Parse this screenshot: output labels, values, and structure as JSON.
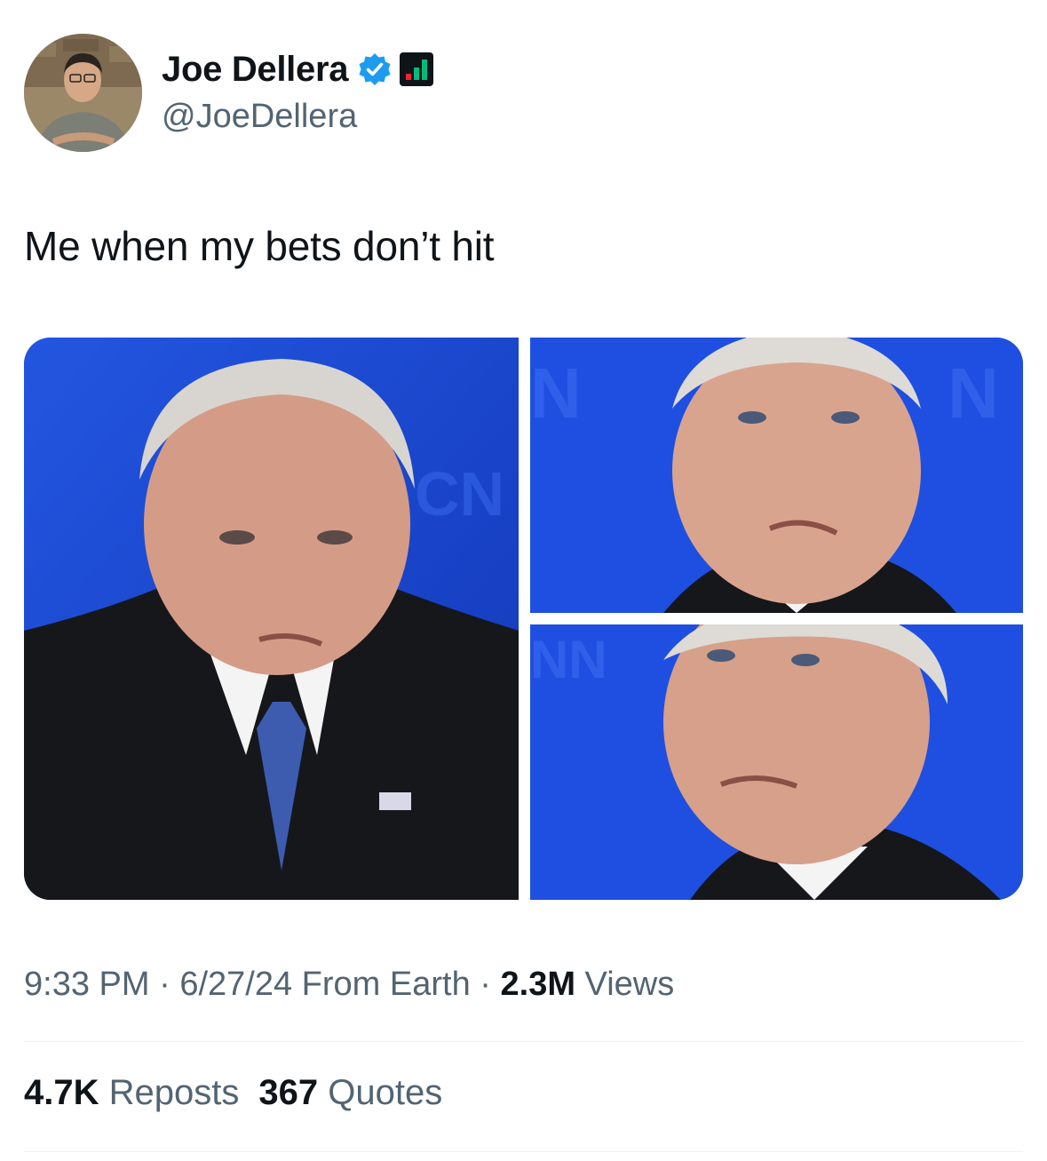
{
  "author": {
    "display_name": "Joe Dellera",
    "handle": "@JoeDellera",
    "verified_color": "#1d9bf0",
    "badges": [
      "verified-badge-icon",
      "affiliate-chart-icon"
    ]
  },
  "tweet": {
    "text": "Me when my bets don’t hit"
  },
  "media": {
    "count": 3,
    "accent_background": "#1d47d6"
  },
  "meta": {
    "time": "9:33 PM",
    "sep1": " · ",
    "date": "6/27/24",
    "source": " From Earth",
    "sep2": " · ",
    "views_count": "2.3M",
    "views_label": " Views"
  },
  "stats": {
    "reposts_count": "4.7K",
    "reposts_label": " Reposts",
    "quotes_count": "367",
    "quotes_label": " Quotes"
  }
}
